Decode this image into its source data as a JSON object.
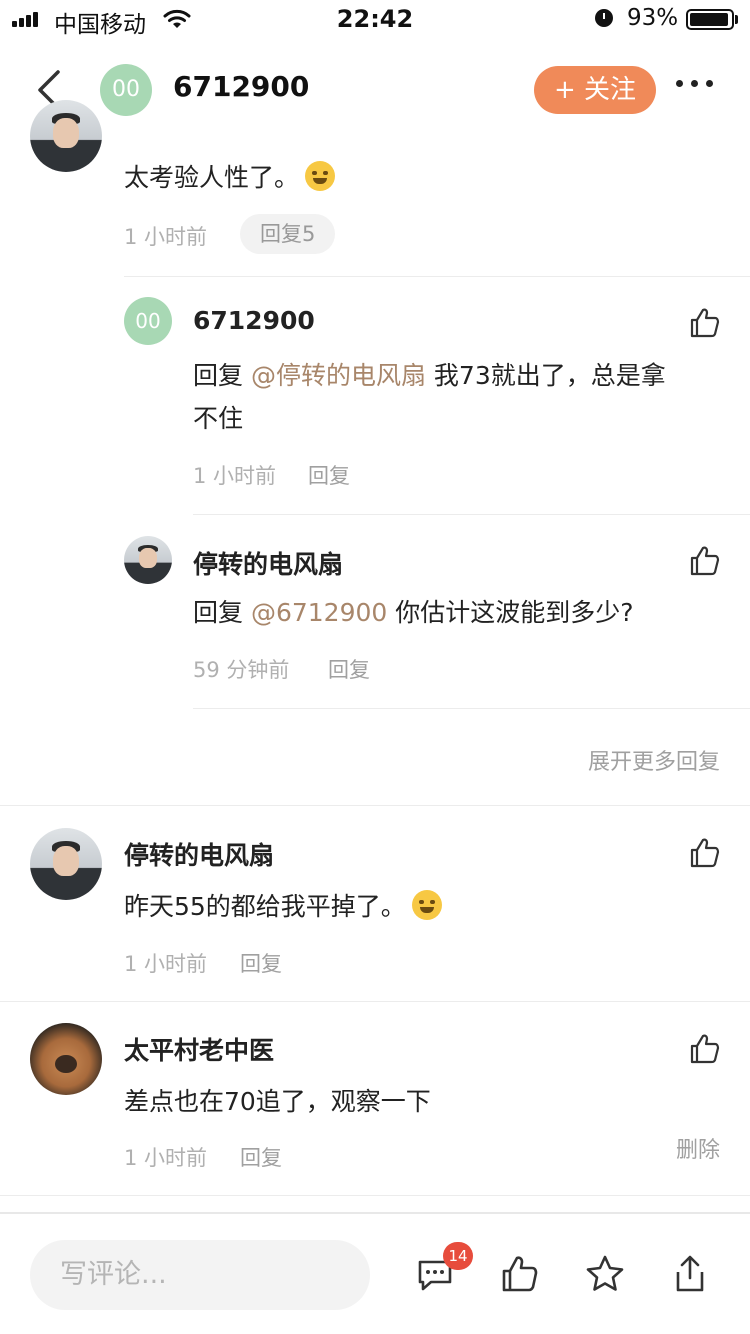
{
  "status_bar": {
    "carrier": "中国移动",
    "time": "22:42",
    "battery_pct": "93%"
  },
  "header": {
    "avatar_text": "00",
    "title": "6712900",
    "follow_label": "+ 关注"
  },
  "top_comment": {
    "text": "太考验人性了。",
    "time": "1 小时前",
    "reply_count_label": "回复5"
  },
  "replies": [
    {
      "avatar_text": "00",
      "user": "6712900",
      "prefix": "回复 ",
      "mention": "@停转的电风扇",
      "text_line1": " 我73就出了，总是拿",
      "text_line2": "不住",
      "time": "1 小时前",
      "reply_label": "回复"
    },
    {
      "user": "停转的电风扇",
      "prefix": "回复 ",
      "mention": "@6712900",
      "text_line1": " 你估计这波能到多少?",
      "time": "59 分钟前",
      "reply_label": "回复"
    }
  ],
  "expand_more_label": "展开更多回复",
  "comments": [
    {
      "user": "停转的电风扇",
      "text": "昨天55的都给我平掉了。",
      "time": "1 小时前",
      "reply_label": "回复"
    },
    {
      "user": "太平村老中医",
      "text": "差点也在70追了，观察一下",
      "time": "1 小时前",
      "reply_label": "回复",
      "delete_label": "删除"
    }
  ],
  "bottom_bar": {
    "input_placeholder": "写评论...",
    "comment_badge": "14"
  },
  "colors": {
    "accent": "#f08a59",
    "mention": "#a8866a",
    "badge": "#e74c3c",
    "avatar_green": "#a8d8b4"
  }
}
